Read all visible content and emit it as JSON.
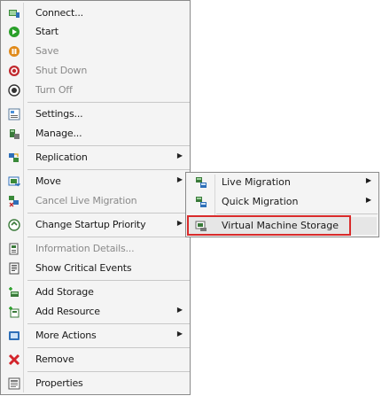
{
  "context_menu": {
    "items": [
      {
        "label": "Connect...",
        "icon": "connect-icon",
        "disabled": false
      },
      {
        "label": "Start",
        "icon": "start-icon",
        "disabled": false
      },
      {
        "label": "Save",
        "icon": "save-state-icon",
        "disabled": true
      },
      {
        "label": "Shut Down",
        "icon": "shut-down-icon",
        "disabled": true
      },
      {
        "label": "Turn Off",
        "icon": "turn-off-icon",
        "disabled": true
      },
      {
        "label": "Settings...",
        "icon": "settings-icon",
        "disabled": false
      },
      {
        "label": "Manage...",
        "icon": "manage-icon",
        "disabled": false
      },
      {
        "label": "Replication",
        "icon": "replication-icon",
        "disabled": false,
        "submenu": true
      },
      {
        "label": "Move",
        "icon": "move-icon",
        "disabled": false,
        "submenu": true
      },
      {
        "label": "Cancel Live Migration",
        "icon": "cancel-live-migration-icon",
        "disabled": true
      },
      {
        "label": "Change Startup Priority",
        "icon": "startup-priority-icon",
        "disabled": false,
        "submenu": true
      },
      {
        "label": "Information Details...",
        "icon": "information-details-icon",
        "disabled": true
      },
      {
        "label": "Show Critical Events",
        "icon": "critical-events-icon",
        "disabled": false
      },
      {
        "label": "Add Storage",
        "icon": "add-storage-icon",
        "disabled": false
      },
      {
        "label": "Add Resource",
        "icon": "add-resource-icon",
        "disabled": false,
        "submenu": true
      },
      {
        "label": "More Actions",
        "icon": "more-actions-icon",
        "disabled": false,
        "submenu": true
      },
      {
        "label": "Remove",
        "icon": "remove-icon",
        "disabled": false
      },
      {
        "label": "Properties",
        "icon": "properties-icon",
        "disabled": false
      }
    ],
    "arrow_glyph": "▶"
  },
  "move_submenu": {
    "items": [
      {
        "label": "Live Migration",
        "icon": "live-migration-icon",
        "submenu": true
      },
      {
        "label": "Quick Migration",
        "icon": "quick-migration-icon",
        "submenu": true
      },
      {
        "label": "Virtual Machine Storage",
        "icon": "vm-storage-icon",
        "highlighted": true
      }
    ]
  },
  "colors": {
    "menu_bg": "#f4f4f4",
    "menu_border": "#8a8a8a",
    "highlight_bg": "#dcdcdc",
    "disabled_text": "#8a8a8a",
    "annotation_red": "#d92b2b"
  }
}
